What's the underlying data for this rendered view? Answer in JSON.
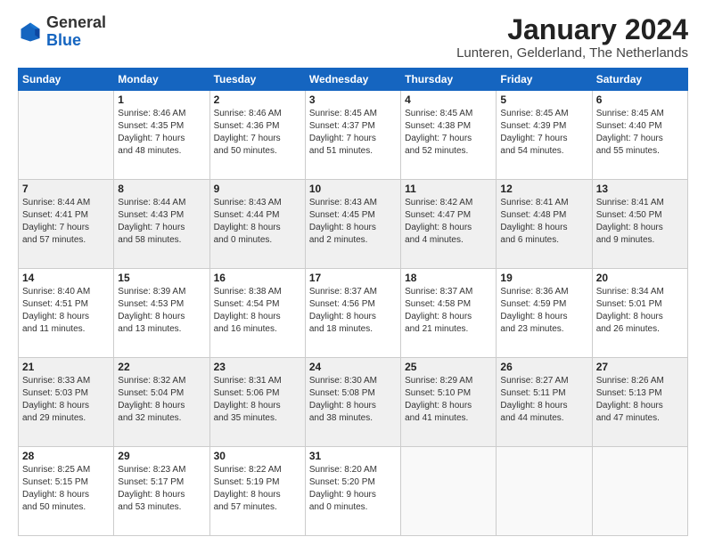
{
  "header": {
    "logo_general": "General",
    "logo_blue": "Blue",
    "month_title": "January 2024",
    "location": "Lunteren, Gelderland, The Netherlands"
  },
  "weekdays": [
    "Sunday",
    "Monday",
    "Tuesday",
    "Wednesday",
    "Thursday",
    "Friday",
    "Saturday"
  ],
  "weeks": [
    [
      {
        "day": "",
        "info": ""
      },
      {
        "day": "1",
        "info": "Sunrise: 8:46 AM\nSunset: 4:35 PM\nDaylight: 7 hours\nand 48 minutes."
      },
      {
        "day": "2",
        "info": "Sunrise: 8:46 AM\nSunset: 4:36 PM\nDaylight: 7 hours\nand 50 minutes."
      },
      {
        "day": "3",
        "info": "Sunrise: 8:45 AM\nSunset: 4:37 PM\nDaylight: 7 hours\nand 51 minutes."
      },
      {
        "day": "4",
        "info": "Sunrise: 8:45 AM\nSunset: 4:38 PM\nDaylight: 7 hours\nand 52 minutes."
      },
      {
        "day": "5",
        "info": "Sunrise: 8:45 AM\nSunset: 4:39 PM\nDaylight: 7 hours\nand 54 minutes."
      },
      {
        "day": "6",
        "info": "Sunrise: 8:45 AM\nSunset: 4:40 PM\nDaylight: 7 hours\nand 55 minutes."
      }
    ],
    [
      {
        "day": "7",
        "info": "Sunrise: 8:44 AM\nSunset: 4:41 PM\nDaylight: 7 hours\nand 57 minutes."
      },
      {
        "day": "8",
        "info": "Sunrise: 8:44 AM\nSunset: 4:43 PM\nDaylight: 7 hours\nand 58 minutes."
      },
      {
        "day": "9",
        "info": "Sunrise: 8:43 AM\nSunset: 4:44 PM\nDaylight: 8 hours\nand 0 minutes."
      },
      {
        "day": "10",
        "info": "Sunrise: 8:43 AM\nSunset: 4:45 PM\nDaylight: 8 hours\nand 2 minutes."
      },
      {
        "day": "11",
        "info": "Sunrise: 8:42 AM\nSunset: 4:47 PM\nDaylight: 8 hours\nand 4 minutes."
      },
      {
        "day": "12",
        "info": "Sunrise: 8:41 AM\nSunset: 4:48 PM\nDaylight: 8 hours\nand 6 minutes."
      },
      {
        "day": "13",
        "info": "Sunrise: 8:41 AM\nSunset: 4:50 PM\nDaylight: 8 hours\nand 9 minutes."
      }
    ],
    [
      {
        "day": "14",
        "info": "Sunrise: 8:40 AM\nSunset: 4:51 PM\nDaylight: 8 hours\nand 11 minutes."
      },
      {
        "day": "15",
        "info": "Sunrise: 8:39 AM\nSunset: 4:53 PM\nDaylight: 8 hours\nand 13 minutes."
      },
      {
        "day": "16",
        "info": "Sunrise: 8:38 AM\nSunset: 4:54 PM\nDaylight: 8 hours\nand 16 minutes."
      },
      {
        "day": "17",
        "info": "Sunrise: 8:37 AM\nSunset: 4:56 PM\nDaylight: 8 hours\nand 18 minutes."
      },
      {
        "day": "18",
        "info": "Sunrise: 8:37 AM\nSunset: 4:58 PM\nDaylight: 8 hours\nand 21 minutes."
      },
      {
        "day": "19",
        "info": "Sunrise: 8:36 AM\nSunset: 4:59 PM\nDaylight: 8 hours\nand 23 minutes."
      },
      {
        "day": "20",
        "info": "Sunrise: 8:34 AM\nSunset: 5:01 PM\nDaylight: 8 hours\nand 26 minutes."
      }
    ],
    [
      {
        "day": "21",
        "info": "Sunrise: 8:33 AM\nSunset: 5:03 PM\nDaylight: 8 hours\nand 29 minutes."
      },
      {
        "day": "22",
        "info": "Sunrise: 8:32 AM\nSunset: 5:04 PM\nDaylight: 8 hours\nand 32 minutes."
      },
      {
        "day": "23",
        "info": "Sunrise: 8:31 AM\nSunset: 5:06 PM\nDaylight: 8 hours\nand 35 minutes."
      },
      {
        "day": "24",
        "info": "Sunrise: 8:30 AM\nSunset: 5:08 PM\nDaylight: 8 hours\nand 38 minutes."
      },
      {
        "day": "25",
        "info": "Sunrise: 8:29 AM\nSunset: 5:10 PM\nDaylight: 8 hours\nand 41 minutes."
      },
      {
        "day": "26",
        "info": "Sunrise: 8:27 AM\nSunset: 5:11 PM\nDaylight: 8 hours\nand 44 minutes."
      },
      {
        "day": "27",
        "info": "Sunrise: 8:26 AM\nSunset: 5:13 PM\nDaylight: 8 hours\nand 47 minutes."
      }
    ],
    [
      {
        "day": "28",
        "info": "Sunrise: 8:25 AM\nSunset: 5:15 PM\nDaylight: 8 hours\nand 50 minutes."
      },
      {
        "day": "29",
        "info": "Sunrise: 8:23 AM\nSunset: 5:17 PM\nDaylight: 8 hours\nand 53 minutes."
      },
      {
        "day": "30",
        "info": "Sunrise: 8:22 AM\nSunset: 5:19 PM\nDaylight: 8 hours\nand 57 minutes."
      },
      {
        "day": "31",
        "info": "Sunrise: 8:20 AM\nSunset: 5:20 PM\nDaylight: 9 hours\nand 0 minutes."
      },
      {
        "day": "",
        "info": ""
      },
      {
        "day": "",
        "info": ""
      },
      {
        "day": "",
        "info": ""
      }
    ]
  ]
}
